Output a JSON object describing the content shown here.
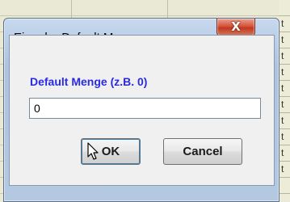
{
  "window": {
    "title": "Eingabe Default Menge",
    "close_glyph": "X"
  },
  "dialog": {
    "prompt": "Default Menge (z.B. 0)",
    "input_value": "0",
    "ok_label": "OK",
    "cancel_label": "Cancel"
  },
  "background": {
    "cell_letters": [
      "t",
      "t",
      "t",
      "t",
      "t",
      "t",
      "t",
      "t",
      "t",
      "t"
    ]
  },
  "colors": {
    "prompt_text": "#2a2ae6",
    "close_button": "#c0381f",
    "window_frame": "#b9cde6"
  }
}
